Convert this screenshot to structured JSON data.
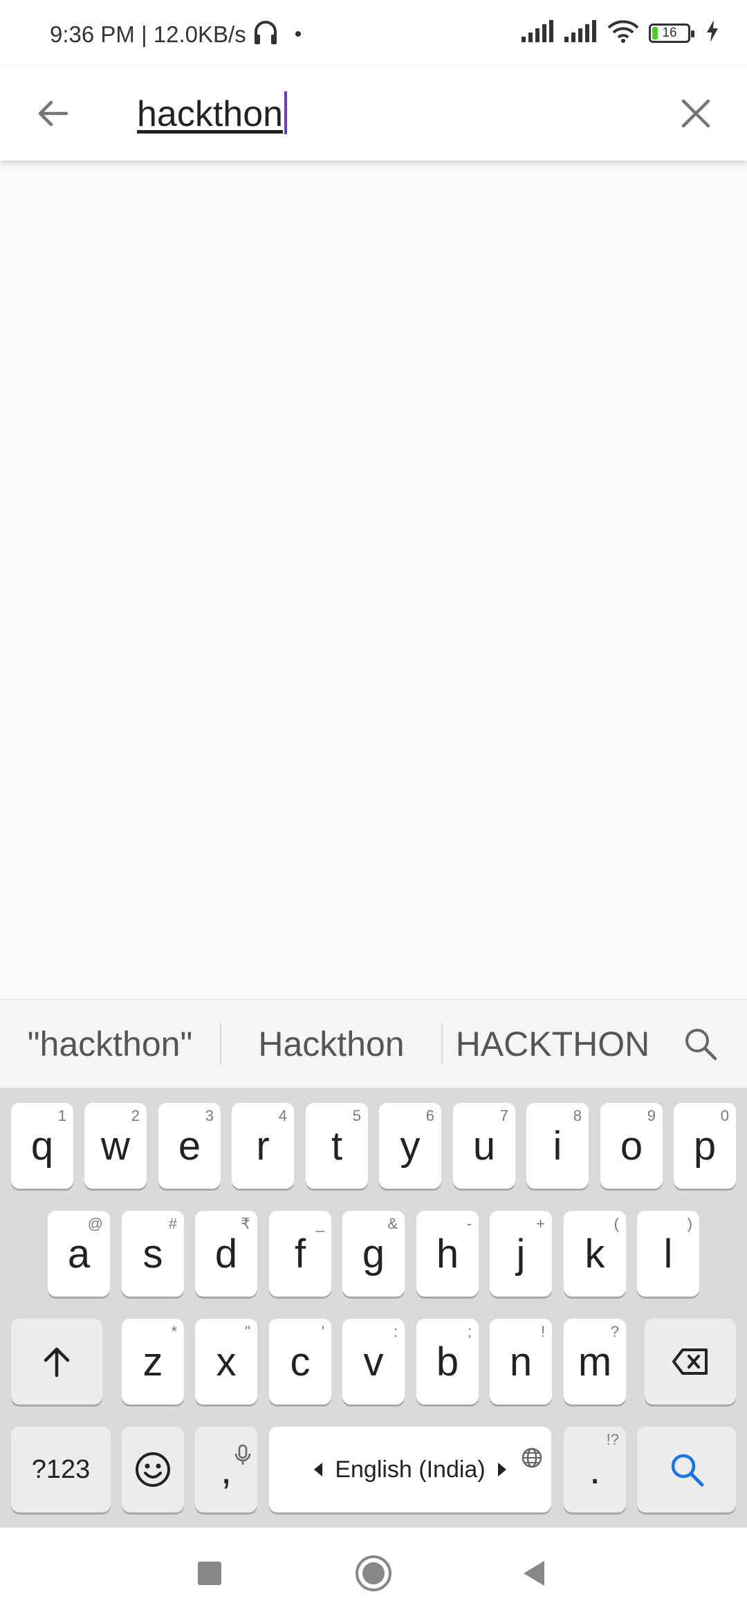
{
  "status_bar": {
    "time_speed": "9:36 PM | 12.0KB/s",
    "dot": "•",
    "battery_level": "16",
    "battery_fraction": 0.16,
    "icons": [
      "headphones-icon",
      "signal-icon",
      "signal-icon",
      "wifi-icon",
      "battery-icon",
      "charging-icon"
    ]
  },
  "search": {
    "query": "hackthon",
    "caret_color": "#6a3fb8",
    "back_icon": "arrow-left-icon",
    "clear_icon": "close-icon"
  },
  "suggestions": [
    "\"hackthon\"",
    "Hackthon",
    "HACKTHON"
  ],
  "keyboard": {
    "row1": [
      {
        "key": "q",
        "hint": "1"
      },
      {
        "key": "w",
        "hint": "2"
      },
      {
        "key": "e",
        "hint": "3"
      },
      {
        "key": "r",
        "hint": "4"
      },
      {
        "key": "t",
        "hint": "5"
      },
      {
        "key": "y",
        "hint": "6"
      },
      {
        "key": "u",
        "hint": "7"
      },
      {
        "key": "i",
        "hint": "8"
      },
      {
        "key": "o",
        "hint": "9"
      },
      {
        "key": "p",
        "hint": "0"
      }
    ],
    "row2": [
      {
        "key": "a",
        "hint": "@"
      },
      {
        "key": "s",
        "hint": "#"
      },
      {
        "key": "d",
        "hint": "₹"
      },
      {
        "key": "f",
        "hint": "_"
      },
      {
        "key": "g",
        "hint": "&"
      },
      {
        "key": "h",
        "hint": "-"
      },
      {
        "key": "j",
        "hint": "+"
      },
      {
        "key": "k",
        "hint": "("
      },
      {
        "key": "l",
        "hint": ")"
      }
    ],
    "row3": [
      {
        "key": "z",
        "hint": "*"
      },
      {
        "key": "x",
        "hint": "\""
      },
      {
        "key": "c",
        "hint": "'"
      },
      {
        "key": "v",
        "hint": ":"
      },
      {
        "key": "b",
        "hint": ";"
      },
      {
        "key": "n",
        "hint": "!"
      },
      {
        "key": "m",
        "hint": "?"
      }
    ],
    "symbols_label": "?123",
    "comma": ",",
    "space_label": "English (India)",
    "period": ".",
    "period_hint": "!?",
    "accent": "#1a73e8"
  },
  "navbar": {
    "icons": [
      "square-icon",
      "circle-icon",
      "triangle-back-icon"
    ]
  }
}
